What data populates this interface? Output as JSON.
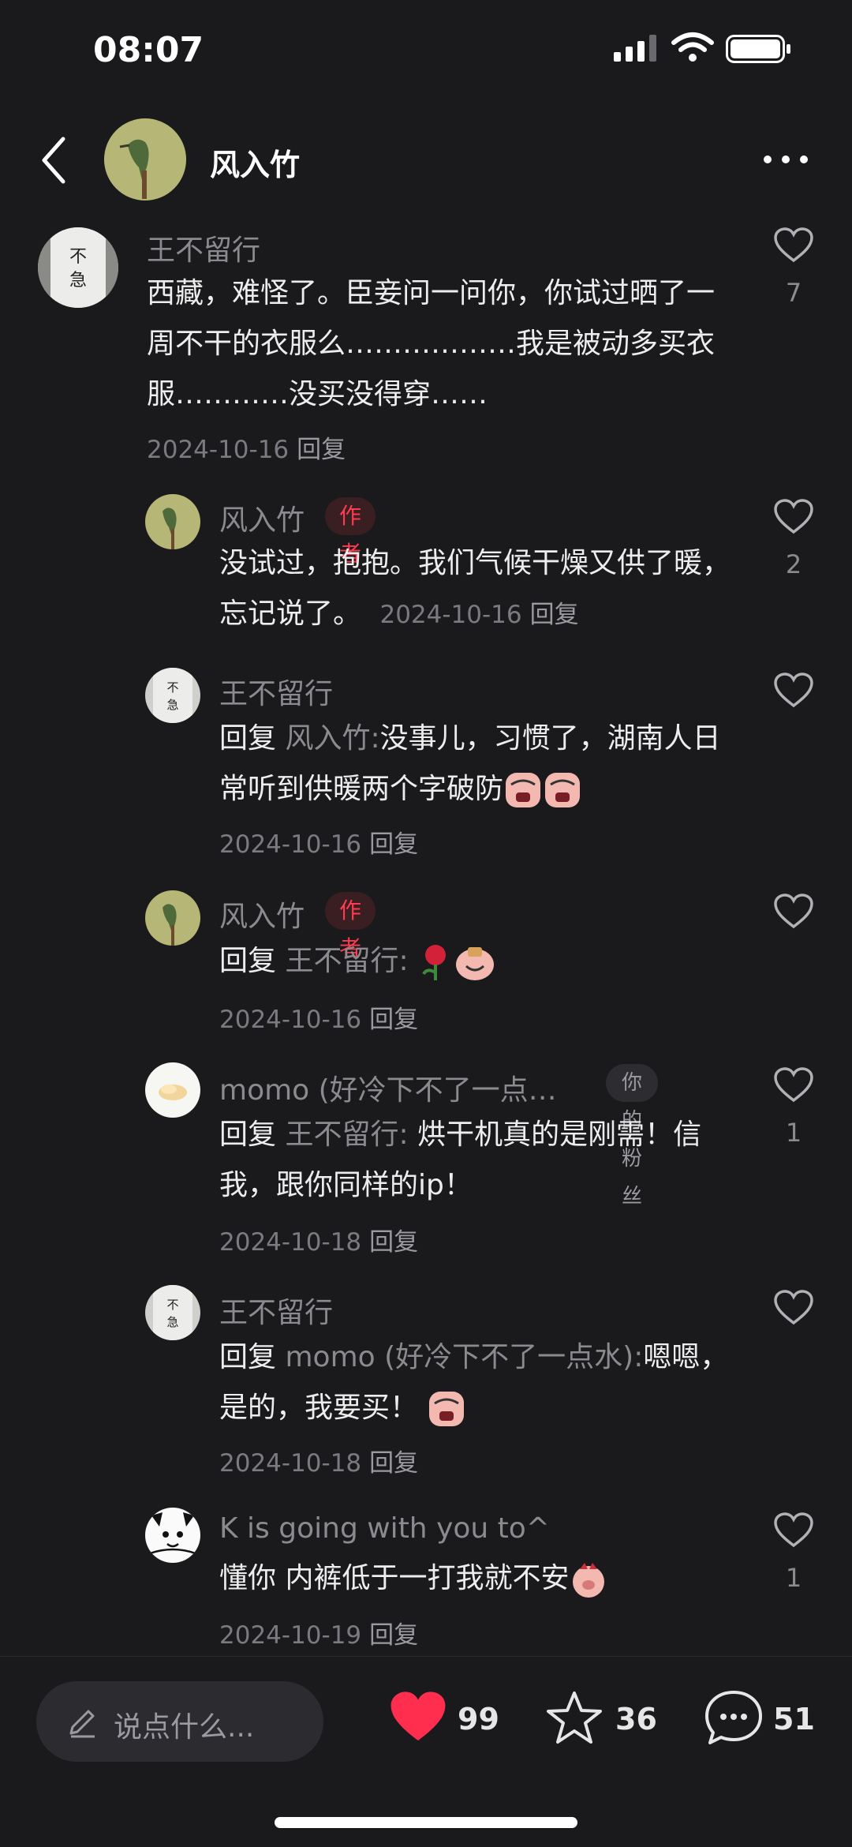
{
  "status_bar": {
    "time": "08:07"
  },
  "header": {
    "title": "风入竹"
  },
  "comments": [
    {
      "user": "王不留行",
      "text": "西藏，难怪了。臣妾问一问你，你试过晒了一周不干的衣服么………………我是被动多买衣服…………没买没得穿……",
      "date": "2024-10-16",
      "reply_label": "回复",
      "likes": "7"
    },
    {
      "user": "风入竹",
      "badge": "作者",
      "text": "没试过，抱抱。我们气候干燥又供了暖，忘记说了。",
      "date": "2024-10-16",
      "reply_label": "回复",
      "likes": "2"
    },
    {
      "user": "王不留行",
      "reply_prefix": "回复",
      "reply_to": "风入竹:",
      "text": "没事儿，习惯了，湖南人日常听到供暖两个字破防",
      "date": "2024-10-16",
      "reply_label": "回复"
    },
    {
      "user": "风入竹",
      "badge": "作者",
      "reply_prefix": "回复",
      "reply_to": "王不留行:",
      "text": "",
      "date": "2024-10-16",
      "reply_label": "回复"
    },
    {
      "user": "momo (好冷下不了一点…",
      "badge": "你的粉丝",
      "reply_prefix": "回复",
      "reply_to": "王不留行:",
      "text": "烘干机真的是刚需！信我，跟你同样的ip！",
      "date": "2024-10-18",
      "reply_label": "回复",
      "likes": "1"
    },
    {
      "user": "王不留行",
      "reply_prefix": "回复",
      "reply_to": "momo (好冷下不了一点水):",
      "text": "嗯嗯，是的，我要买！",
      "date": "2024-10-18",
      "reply_label": "回复"
    },
    {
      "user": "K is going with you to^",
      "text": "懂你 内裤低于一打我就不安",
      "date": "2024-10-19",
      "reply_label": "回复",
      "likes": "1"
    }
  ],
  "bottom_bar": {
    "input_placeholder": "说点什么...",
    "likes": "99",
    "stars": "36",
    "comments": "51"
  },
  "colors": {
    "background": "#1a1a1d",
    "like_red": "#ff2d4e",
    "author_badge": "#ff3b4f"
  },
  "icons": [
    "back-icon",
    "more-icon",
    "heart-icon",
    "star-icon",
    "comment-icon",
    "pen-icon"
  ]
}
